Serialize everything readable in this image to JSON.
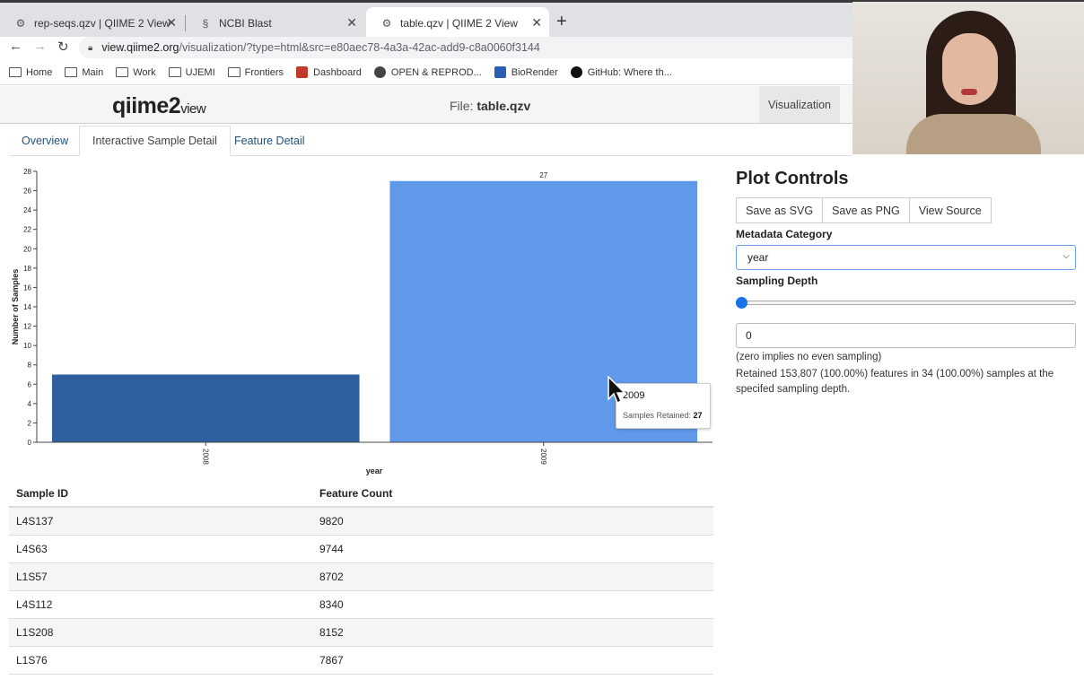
{
  "browser": {
    "tabs": [
      {
        "label": "rep-seqs.qzv | QIIME 2 View",
        "icon": "qiime-icon"
      },
      {
        "label": "NCBI Blast",
        "icon": "dna-icon"
      },
      {
        "label": "table.qzv | QIIME 2 View",
        "icon": "qiime-icon",
        "active": true
      }
    ],
    "url_host": "view.qiime2.org",
    "url_path": "/visualization/?type=html&src=e80aec78-4a3a-42ac-add9-c8a0060f3144",
    "bookmarks": [
      "Home",
      "Main",
      "Work",
      "UJEMI",
      "Frontiers",
      "Dashboard",
      "OPEN & REPROD...",
      "BioRender",
      "GitHub: Where th..."
    ]
  },
  "header": {
    "logo_main": "qiime2",
    "logo_sub": "view",
    "file_prefix": "File: ",
    "file_name": "table.qzv",
    "vis_button": "Visualization"
  },
  "subtabs": [
    "Overview",
    "Interactive Sample Detail",
    "Feature Detail"
  ],
  "chart_data": {
    "type": "bar",
    "categories": [
      "2008",
      "2009"
    ],
    "values": [
      7,
      27
    ],
    "data_labels": [
      "",
      "27"
    ],
    "xlabel": "year",
    "ylabel": "Number of Samples",
    "ylim": [
      0,
      28
    ],
    "yticks": [
      0,
      2,
      4,
      6,
      8,
      10,
      12,
      14,
      16,
      18,
      20,
      22,
      24,
      26,
      28
    ],
    "colors": [
      "#2f5f9e",
      "#6199ea"
    ],
    "grid": false
  },
  "tooltip": {
    "title": "2009",
    "label": "Samples Retained: ",
    "value": "27"
  },
  "table": {
    "headers": [
      "Sample ID",
      "Feature Count"
    ],
    "rows": [
      [
        "L4S137",
        "9820"
      ],
      [
        "L4S63",
        "9744"
      ],
      [
        "L1S57",
        "8702"
      ],
      [
        "L4S112",
        "8340"
      ],
      [
        "L1S208",
        "8152"
      ],
      [
        "L1S76",
        "7867"
      ]
    ]
  },
  "controls": {
    "title": "Plot Controls",
    "buttons": [
      "Save as SVG",
      "Save as PNG",
      "View Source"
    ],
    "metadata_label": "Metadata Category",
    "metadata_value": "year",
    "depth_label": "Sampling Depth",
    "depth_value": "0",
    "slider_level": 0,
    "help1": "(zero implies no even sampling)",
    "help2": "Retained 153,807 (100.00%) features in 34 (100.00%) samples at the specifed sampling depth."
  }
}
